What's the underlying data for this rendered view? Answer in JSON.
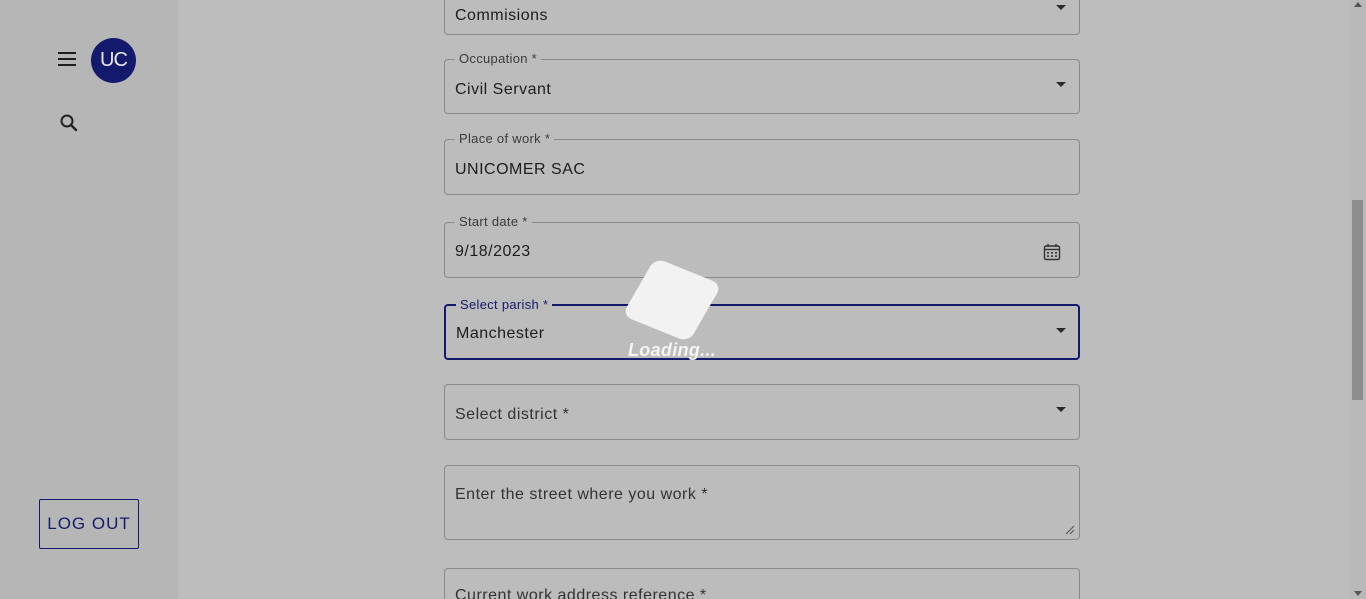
{
  "sidebar": {
    "avatar_initials": "UC",
    "logout_label": "LOG OUT",
    "icons": {
      "menu": "hamburger-menu-icon",
      "search": "search-icon"
    }
  },
  "form": {
    "commissions": {
      "value": "Commisions"
    },
    "occupation": {
      "label": "Occupation *",
      "value": "Civil Servant"
    },
    "place_of_work": {
      "label": "Place of work *",
      "value": "UNICOMER SAC"
    },
    "start_date": {
      "label": "Start date *",
      "value": "9/18/2023"
    },
    "parish": {
      "label": "Select parish *",
      "value": "Manchester"
    },
    "district": {
      "placeholder": "Select district *"
    },
    "street": {
      "placeholder": "Enter the street where you work *"
    },
    "address_reference": {
      "placeholder": "Current work address reference *"
    }
  },
  "overlay": {
    "loading_text": "Loading..."
  },
  "colors": {
    "accent": "#141a6b",
    "overlay_bg": "#bdbdbd"
  }
}
